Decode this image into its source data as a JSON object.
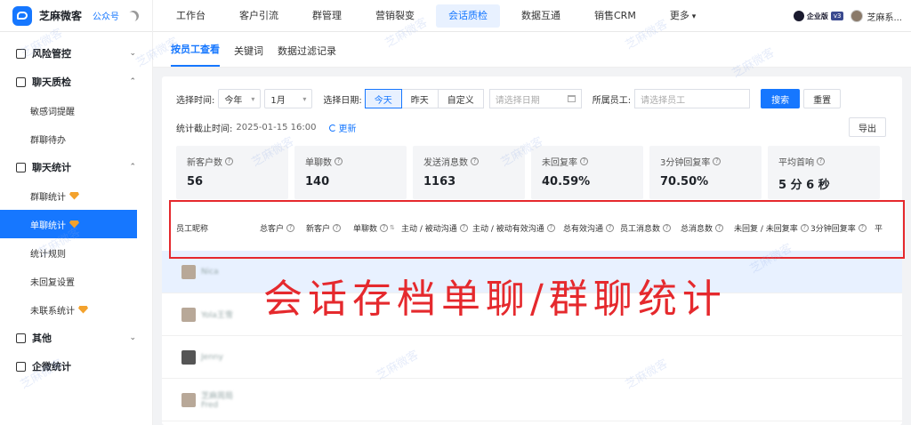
{
  "app": {
    "name": "芝麻微客",
    "gzh": "公众号"
  },
  "topnav": [
    "工作台",
    "客户引流",
    "群管理",
    "营销裂变",
    "会话质检",
    "数据互通",
    "销售CRM",
    "更多"
  ],
  "topnav_active": 4,
  "top_right": {
    "edition": "企业版",
    "version": "v3",
    "user": "芝麻系..."
  },
  "sidebar": {
    "risk": "风险管控",
    "chat_qc": "聊天质检",
    "chat_qc_items": [
      "敏感词提醒",
      "群聊待办"
    ],
    "chat_stats": "聊天统计",
    "chat_stats_items": [
      "群聊统计",
      "单聊统计",
      "统计规则",
      "未回复设置",
      "未联系统计"
    ],
    "other": "其他",
    "wecom": "企微统计"
  },
  "subtabs": [
    "按员工查看",
    "关键词",
    "数据过滤记录"
  ],
  "filters": {
    "time_label": "选择时间:",
    "year": "今年",
    "month": "1月",
    "date_label": "选择日期:",
    "date_buttons": [
      "今天",
      "昨天",
      "自定义"
    ],
    "date_placeholder": "请选择日期",
    "emp_label": "所属员工:",
    "emp_placeholder": "请选择员工",
    "search": "搜索",
    "reset": "重置"
  },
  "stat_time": {
    "label": "统计截止时间:",
    "value": "2025-01-15 16:00",
    "refresh": "更新",
    "export": "导出"
  },
  "cards": [
    {
      "label": "新客户数",
      "value": "56"
    },
    {
      "label": "单聊数",
      "value": "140"
    },
    {
      "label": "发送消息数",
      "value": "1163"
    },
    {
      "label": "未回复率",
      "value": "40.59%"
    },
    {
      "label": "3分钟回复率",
      "value": "70.50%"
    },
    {
      "label": "平均首响",
      "value": "5 分 6 秒"
    }
  ],
  "columns": [
    "员工昵称",
    "总客户",
    "新客户",
    "单聊数",
    "主动 / 被动沟通",
    "主动 / 被动有效沟通",
    "总有效沟通",
    "员工消息数",
    "总消息数",
    "未回复 / 未回复率",
    "3分钟回复率",
    "平"
  ],
  "rows": [
    {
      "name": "Nica"
    },
    {
      "name": "Yola王雪"
    },
    {
      "name": "Jenny"
    },
    {
      "name": "芝麻周局 Fred"
    }
  ],
  "overlay_text": "会话存档单聊/群聊统计",
  "watermark": "芝麻微客"
}
